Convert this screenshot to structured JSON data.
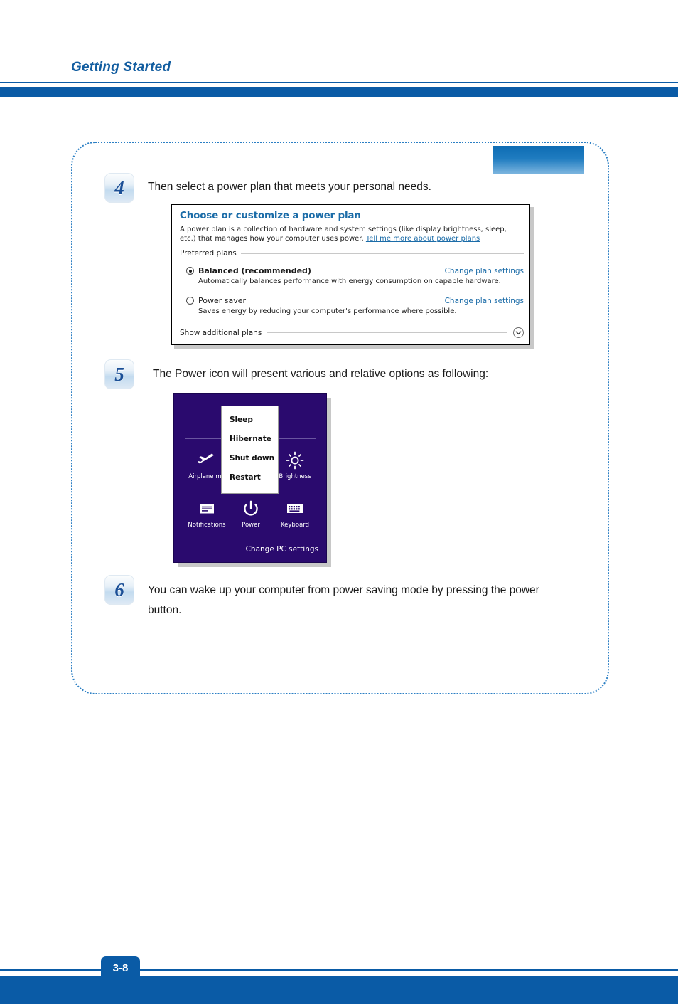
{
  "header": {
    "title": "Getting Started",
    "accent_color": "#0a5ba6",
    "title_color": "#125da0"
  },
  "steps": [
    {
      "number": "4",
      "text": "Then select a power plan that meets your personal needs."
    },
    {
      "number": "5",
      "text": "The Power icon will present various and relative options as following:"
    },
    {
      "number": "6",
      "line1": "You can wake up your computer from power saving mode by pressing the power",
      "line2": "button."
    }
  ],
  "power_plan_dialog": {
    "heading": "Choose or customize a power plan",
    "description_part1": "A power plan is a collection of hardware and system settings (like display brightness, sleep, etc.) that manages how your computer uses power. ",
    "description_link": "Tell me more about power plans",
    "preferred_plans_label": "Preferred plans",
    "plans": [
      {
        "name": "Balanced (recommended)",
        "selected": true,
        "description": "Automatically balances performance with energy consumption on capable hardware.",
        "link": "Change plan settings"
      },
      {
        "name": "Power saver",
        "selected": false,
        "description": "Saves energy by reducing your computer's performance where possible.",
        "link": "Change plan settings"
      }
    ],
    "show_additional_label": "Show additional plans",
    "chevron_icon": "chevron-down-icon",
    "link_color": "#1b6ca8",
    "heading_color": "#1b6ca8"
  },
  "charm_panel": {
    "background_color": "#2a0a6e",
    "tiles": [
      {
        "label": "Airplane mo",
        "icon": "airplane-icon"
      },
      {
        "label": "Brightness",
        "icon": "brightness-icon"
      },
      {
        "label": "Notifications",
        "icon": "notifications-icon"
      },
      {
        "label": "Power",
        "icon": "power-icon"
      },
      {
        "label": "Keyboard",
        "icon": "keyboard-icon"
      }
    ],
    "change_pc_settings": "Change PC settings",
    "power_menu": [
      "Sleep",
      "Hibernate",
      "Shut down",
      "Restart"
    ]
  },
  "footer": {
    "page_number": "3-8"
  }
}
